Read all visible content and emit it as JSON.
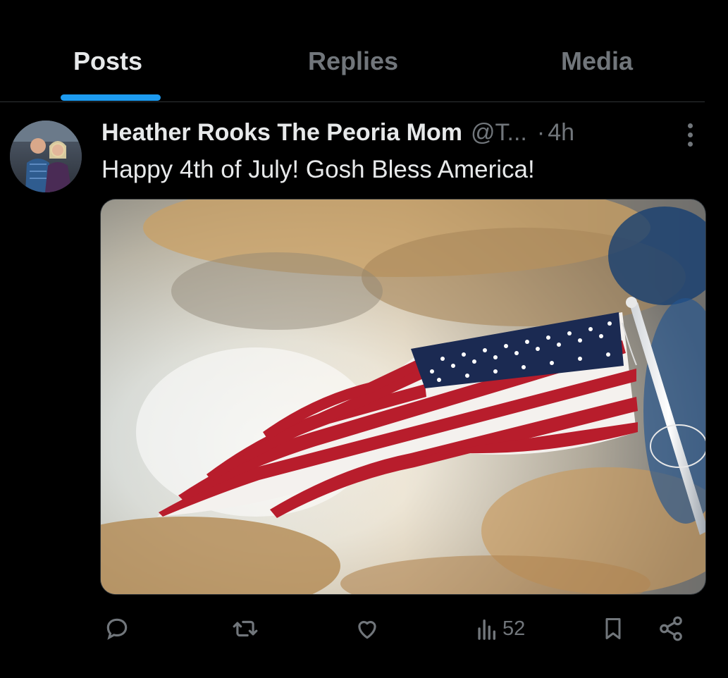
{
  "tabs": [
    {
      "label": "Posts",
      "active": true
    },
    {
      "label": "Replies",
      "active": false
    },
    {
      "label": "Media",
      "active": false
    }
  ],
  "post": {
    "display_name": "Heather Rooks The Peoria Mom",
    "handle": "@T...",
    "separator": "·",
    "time": "4h",
    "text": "Happy 4th of July! Gosh Bless America!",
    "media_icon": "american-flag-photo"
  },
  "actions": {
    "reply_icon": "reply-icon",
    "repost_icon": "repost-icon",
    "like_icon": "like-icon",
    "views_icon": "views-icon",
    "views_count": "52",
    "bookmark_icon": "bookmark-icon",
    "share_icon": "share-icon"
  },
  "colors": {
    "background": "#000000",
    "text_primary": "#e7e9ea",
    "text_secondary": "#71767b",
    "accent": "#1d9bf0",
    "divider": "#2f3336"
  }
}
